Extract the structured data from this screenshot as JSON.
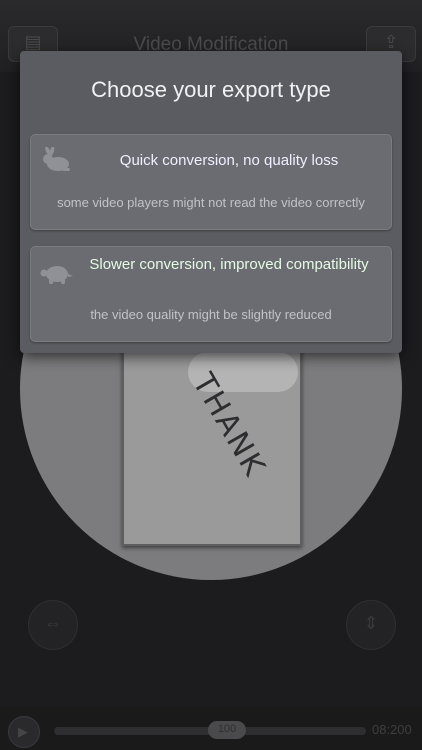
{
  "app": {
    "title": "Video Modification",
    "left_button_icon": "film-icon",
    "right_button_icon": "share-icon"
  },
  "player": {
    "photo_scribble": "THANK",
    "thumb_label": "100",
    "time": "08:200"
  },
  "modal": {
    "title": "Choose your export type",
    "options": [
      {
        "icon": "rabbit-icon",
        "title": "Quick conversion, no quality loss",
        "subtitle": "some video players might not read the video correctly"
      },
      {
        "icon": "turtle-icon",
        "title": "Slower conversion, improved compatibility",
        "subtitle": "the video quality might be slightly reduced"
      }
    ]
  },
  "colors": {
    "modal_bg": "#5b5c62",
    "option_bg": "#6b6c71",
    "quick_title": "#eef0ff",
    "slow_title": "#e5fbe5"
  }
}
